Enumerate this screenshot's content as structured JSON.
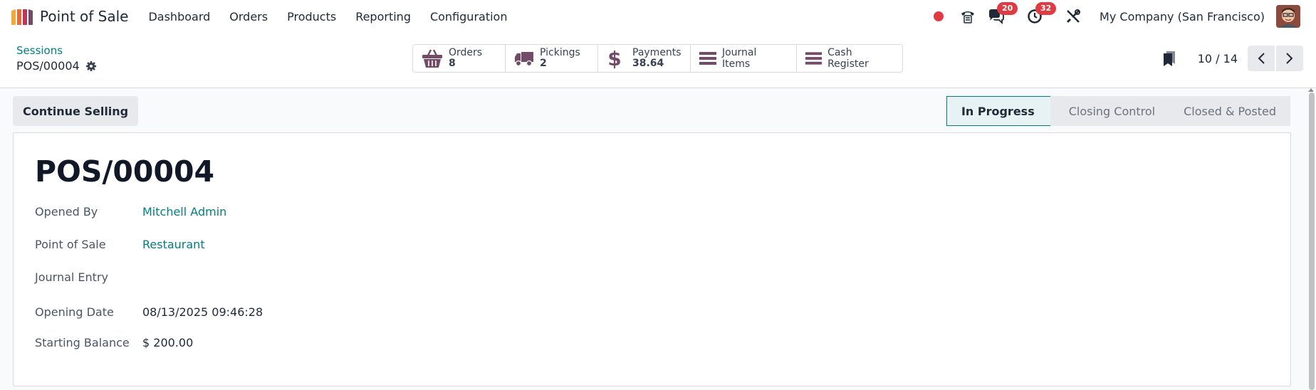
{
  "navbar": {
    "app_name": "Point of Sale",
    "menu": [
      "Dashboard",
      "Orders",
      "Products",
      "Reporting",
      "Configuration"
    ],
    "messages_badge": "20",
    "activities_badge": "32",
    "company": "My Company (San Francisco)",
    "recording_color": "#e03b43"
  },
  "breadcrumb": {
    "parent": "Sessions",
    "current": "POS/00004"
  },
  "smart_buttons": {
    "orders": {
      "label": "Orders",
      "value": "8",
      "icon": "basket-icon"
    },
    "pickings": {
      "label": "Pickings",
      "value": "2",
      "icon": "truck-icon"
    },
    "payments": {
      "label": "Payments",
      "value": "38.64",
      "icon": "dollar-icon"
    },
    "journal_items": {
      "label": "Journal Items",
      "icon": "list-icon"
    },
    "cash_register": {
      "label": "Cash Register",
      "icon": "list-icon"
    }
  },
  "pager": {
    "value": "10 / 14"
  },
  "actions": {
    "continue_selling": "Continue Selling"
  },
  "statusbar": {
    "stages": [
      "In Progress",
      "Closing Control",
      "Closed & Posted"
    ],
    "active": "In Progress"
  },
  "form": {
    "title": "POS/00004",
    "fields": {
      "opened_by": {
        "label": "Opened By",
        "value": "Mitchell Admin"
      },
      "point_of_sale": {
        "label": "Point of Sale",
        "value": "Restaurant"
      },
      "journal_entry": {
        "label": "Journal Entry",
        "value": ""
      },
      "opening_date": {
        "label": "Opening Date",
        "value": "08/13/2025 09:46:28"
      },
      "starting_balance": {
        "label": "Starting Balance",
        "value": "$ 200.00"
      }
    }
  },
  "colors": {
    "accent": "#017e84",
    "icon": "#714b67",
    "badge": "#e03b43"
  }
}
